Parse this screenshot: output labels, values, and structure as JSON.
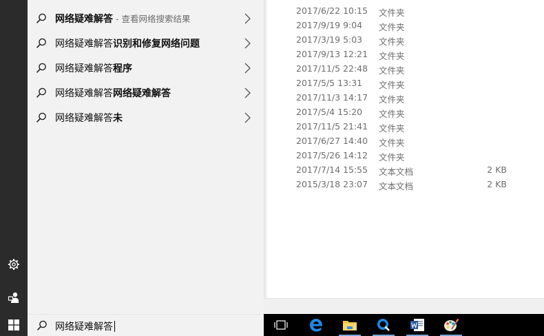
{
  "search_panel": {
    "suggestions": [
      {
        "prefix": "网络疑难解答",
        "bold": "",
        "sub": " - 查看网络搜索结果"
      },
      {
        "prefix": "网络疑难解答",
        "bold": "识别和修复网络问题",
        "sub": ""
      },
      {
        "prefix": "网络疑难解答",
        "bold": "程序",
        "sub": ""
      },
      {
        "prefix": "网络疑难解答",
        "bold": "网络疑难解答",
        "sub": ""
      },
      {
        "prefix": "网络疑难解答",
        "bold": "未",
        "sub": ""
      }
    ]
  },
  "search_box": {
    "value": "网络疑难解答"
  },
  "file_list": {
    "rows": [
      {
        "date": "2017/6/22 10:15",
        "type": "文件夹",
        "size": ""
      },
      {
        "date": "2017/9/19 9:04",
        "type": "文件夹",
        "size": ""
      },
      {
        "date": "2017/3/19 5:03",
        "type": "文件夹",
        "size": ""
      },
      {
        "date": "2017/9/13 12:21",
        "type": "文件夹",
        "size": ""
      },
      {
        "date": "2017/11/5 22:48",
        "type": "文件夹",
        "size": ""
      },
      {
        "date": "2017/5/5 13:31",
        "type": "文件夹",
        "size": ""
      },
      {
        "date": "2017/11/3 14:17",
        "type": "文件夹",
        "size": ""
      },
      {
        "date": "2017/5/4 15:20",
        "type": "文件夹",
        "size": ""
      },
      {
        "date": "2017/11/5 21:41",
        "type": "文件夹",
        "size": ""
      },
      {
        "date": "2017/6/27 14:40",
        "type": "文件夹",
        "size": ""
      },
      {
        "date": "2017/5/26 14:12",
        "type": "文件夹",
        "size": ""
      },
      {
        "date": "2017/7/14 15:55",
        "type": "文本文档",
        "size": "2 KB"
      },
      {
        "date": "2015/3/18 23:07",
        "type": "文本文档",
        "size": "2 KB"
      }
    ]
  },
  "left_rail": {
    "icons": [
      "gear-icon",
      "user-feedback-icon"
    ]
  },
  "taskbar": {
    "icons": [
      "task-view-icon",
      "edge-icon",
      "file-explorer-icon",
      "search-app-icon",
      "word-icon",
      "paint-icon"
    ]
  },
  "colors": {
    "rail": "#2b2b2b",
    "panel": "#f2f2f2",
    "taskbar": "#000000",
    "accent": "#0078d7"
  }
}
